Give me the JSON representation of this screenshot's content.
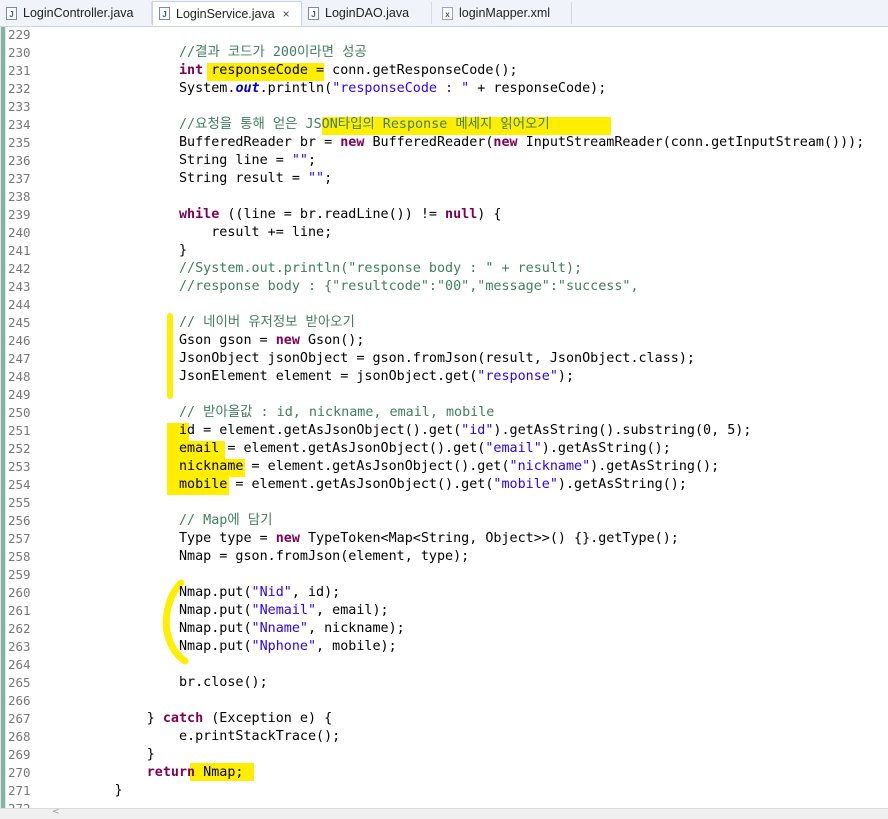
{
  "tabs": [
    {
      "label": "LoginController.java",
      "icon": "java-file-icon",
      "active": false
    },
    {
      "label": "LoginService.java",
      "icon": "java-file-icon",
      "active": true,
      "close": "×"
    },
    {
      "label": "LoginDAO.java",
      "icon": "java-file-icon",
      "active": false
    },
    {
      "label": "loginMapper.xml",
      "icon": "xml-file-icon",
      "active": false
    }
  ],
  "highlight_color": "#ffee00",
  "lines": [
    {
      "n": "229",
      "c": ""
    },
    {
      "n": "230",
      "c": "                //결과 코드가 200이라면 성공"
    },
    {
      "n": "231",
      "c": "                int responseCode = conn.getResponseCode();"
    },
    {
      "n": "232",
      "c": "                System.out.println(\"responseCode : \" + responseCode);"
    },
    {
      "n": "233",
      "c": ""
    },
    {
      "n": "234",
      "c": "                //요청을 통해 얻은 JSON타입의 Response 메세지 읽어오기"
    },
    {
      "n": "235",
      "c": "                BufferedReader br = new BufferedReader(new InputStreamReader(conn.getInputStream()));"
    },
    {
      "n": "236",
      "c": "                String line = \"\";"
    },
    {
      "n": "237",
      "c": "                String result = \"\";"
    },
    {
      "n": "238",
      "c": ""
    },
    {
      "n": "239",
      "c": "                while ((line = br.readLine()) != null) {"
    },
    {
      "n": "240",
      "c": "                    result += line;"
    },
    {
      "n": "241",
      "c": "                }"
    },
    {
      "n": "242",
      "c": "                //System.out.println(\"response body : \" + result);"
    },
    {
      "n": "243",
      "c": "                //response body : {\"resultcode\":\"00\",\"message\":\"success\","
    },
    {
      "n": "244",
      "c": ""
    },
    {
      "n": "245",
      "c": "                // 네이버 유저정보 받아오기"
    },
    {
      "n": "246",
      "c": "                Gson gson = new Gson();"
    },
    {
      "n": "247",
      "c": "                JsonObject jsonObject = gson.fromJson(result, JsonObject.class);"
    },
    {
      "n": "248",
      "c": "                JsonElement element = jsonObject.get(\"response\");"
    },
    {
      "n": "249",
      "c": ""
    },
    {
      "n": "250",
      "c": "                // 받아올값 : id, nickname, email, mobile"
    },
    {
      "n": "251",
      "c": "                id = element.getAsJsonObject().get(\"id\").getAsString().substring(0, 5);"
    },
    {
      "n": "252",
      "c": "                email = element.getAsJsonObject().get(\"email\").getAsString();"
    },
    {
      "n": "253",
      "c": "                nickname = element.getAsJsonObject().get(\"nickname\").getAsString();"
    },
    {
      "n": "254",
      "c": "                mobile = element.getAsJsonObject().get(\"mobile\").getAsString();"
    },
    {
      "n": "255",
      "c": ""
    },
    {
      "n": "256",
      "c": "                // Map에 담기"
    },
    {
      "n": "257",
      "c": "                Type type = new TypeToken<Map<String, Object>>() {}.getType();"
    },
    {
      "n": "258",
      "c": "                Nmap = gson.fromJson(element, type);"
    },
    {
      "n": "259",
      "c": ""
    },
    {
      "n": "260",
      "c": "                Nmap.put(\"Nid\", id);"
    },
    {
      "n": "261",
      "c": "                Nmap.put(\"Nemail\", email);"
    },
    {
      "n": "262",
      "c": "                Nmap.put(\"Nname\", nickname);"
    },
    {
      "n": "263",
      "c": "                Nmap.put(\"Nphone\", mobile);"
    },
    {
      "n": "264",
      "c": ""
    },
    {
      "n": "265",
      "c": "                br.close();"
    },
    {
      "n": "266",
      "c": ""
    },
    {
      "n": "267",
      "c": "            } catch (Exception e) {"
    },
    {
      "n": "268",
      "c": "                e.printStackTrace();"
    },
    {
      "n": "269",
      "c": "            }"
    },
    {
      "n": "270",
      "c": "            return Nmap;"
    },
    {
      "n": "271",
      "c": "        }"
    },
    {
      "n": "272",
      "c": ""
    }
  ]
}
